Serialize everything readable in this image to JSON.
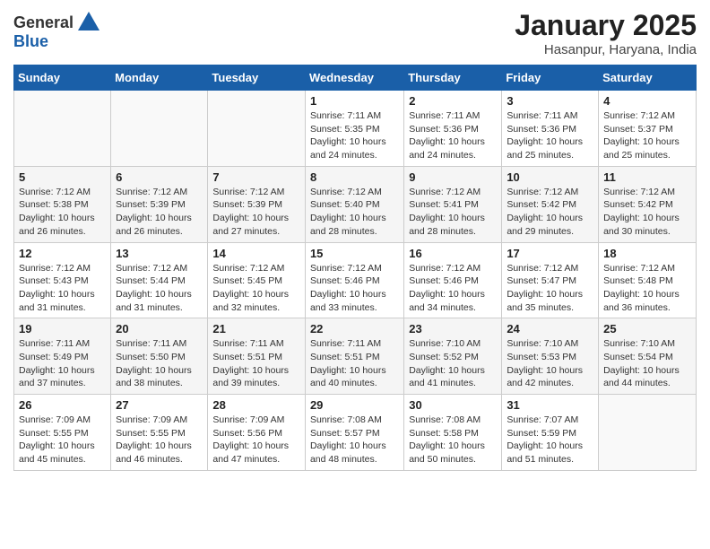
{
  "header": {
    "logo_line1": "General",
    "logo_line2": "Blue",
    "month_title": "January 2025",
    "location": "Hasanpur, Haryana, India"
  },
  "weekdays": [
    "Sunday",
    "Monday",
    "Tuesday",
    "Wednesday",
    "Thursday",
    "Friday",
    "Saturday"
  ],
  "weeks": [
    [
      {
        "day": "",
        "info": ""
      },
      {
        "day": "",
        "info": ""
      },
      {
        "day": "",
        "info": ""
      },
      {
        "day": "1",
        "info": "Sunrise: 7:11 AM\nSunset: 5:35 PM\nDaylight: 10 hours\nand 24 minutes."
      },
      {
        "day": "2",
        "info": "Sunrise: 7:11 AM\nSunset: 5:36 PM\nDaylight: 10 hours\nand 24 minutes."
      },
      {
        "day": "3",
        "info": "Sunrise: 7:11 AM\nSunset: 5:36 PM\nDaylight: 10 hours\nand 25 minutes."
      },
      {
        "day": "4",
        "info": "Sunrise: 7:12 AM\nSunset: 5:37 PM\nDaylight: 10 hours\nand 25 minutes."
      }
    ],
    [
      {
        "day": "5",
        "info": "Sunrise: 7:12 AM\nSunset: 5:38 PM\nDaylight: 10 hours\nand 26 minutes."
      },
      {
        "day": "6",
        "info": "Sunrise: 7:12 AM\nSunset: 5:39 PM\nDaylight: 10 hours\nand 26 minutes."
      },
      {
        "day": "7",
        "info": "Sunrise: 7:12 AM\nSunset: 5:39 PM\nDaylight: 10 hours\nand 27 minutes."
      },
      {
        "day": "8",
        "info": "Sunrise: 7:12 AM\nSunset: 5:40 PM\nDaylight: 10 hours\nand 28 minutes."
      },
      {
        "day": "9",
        "info": "Sunrise: 7:12 AM\nSunset: 5:41 PM\nDaylight: 10 hours\nand 28 minutes."
      },
      {
        "day": "10",
        "info": "Sunrise: 7:12 AM\nSunset: 5:42 PM\nDaylight: 10 hours\nand 29 minutes."
      },
      {
        "day": "11",
        "info": "Sunrise: 7:12 AM\nSunset: 5:42 PM\nDaylight: 10 hours\nand 30 minutes."
      }
    ],
    [
      {
        "day": "12",
        "info": "Sunrise: 7:12 AM\nSunset: 5:43 PM\nDaylight: 10 hours\nand 31 minutes."
      },
      {
        "day": "13",
        "info": "Sunrise: 7:12 AM\nSunset: 5:44 PM\nDaylight: 10 hours\nand 31 minutes."
      },
      {
        "day": "14",
        "info": "Sunrise: 7:12 AM\nSunset: 5:45 PM\nDaylight: 10 hours\nand 32 minutes."
      },
      {
        "day": "15",
        "info": "Sunrise: 7:12 AM\nSunset: 5:46 PM\nDaylight: 10 hours\nand 33 minutes."
      },
      {
        "day": "16",
        "info": "Sunrise: 7:12 AM\nSunset: 5:46 PM\nDaylight: 10 hours\nand 34 minutes."
      },
      {
        "day": "17",
        "info": "Sunrise: 7:12 AM\nSunset: 5:47 PM\nDaylight: 10 hours\nand 35 minutes."
      },
      {
        "day": "18",
        "info": "Sunrise: 7:12 AM\nSunset: 5:48 PM\nDaylight: 10 hours\nand 36 minutes."
      }
    ],
    [
      {
        "day": "19",
        "info": "Sunrise: 7:11 AM\nSunset: 5:49 PM\nDaylight: 10 hours\nand 37 minutes."
      },
      {
        "day": "20",
        "info": "Sunrise: 7:11 AM\nSunset: 5:50 PM\nDaylight: 10 hours\nand 38 minutes."
      },
      {
        "day": "21",
        "info": "Sunrise: 7:11 AM\nSunset: 5:51 PM\nDaylight: 10 hours\nand 39 minutes."
      },
      {
        "day": "22",
        "info": "Sunrise: 7:11 AM\nSunset: 5:51 PM\nDaylight: 10 hours\nand 40 minutes."
      },
      {
        "day": "23",
        "info": "Sunrise: 7:10 AM\nSunset: 5:52 PM\nDaylight: 10 hours\nand 41 minutes."
      },
      {
        "day": "24",
        "info": "Sunrise: 7:10 AM\nSunset: 5:53 PM\nDaylight: 10 hours\nand 42 minutes."
      },
      {
        "day": "25",
        "info": "Sunrise: 7:10 AM\nSunset: 5:54 PM\nDaylight: 10 hours\nand 44 minutes."
      }
    ],
    [
      {
        "day": "26",
        "info": "Sunrise: 7:09 AM\nSunset: 5:55 PM\nDaylight: 10 hours\nand 45 minutes."
      },
      {
        "day": "27",
        "info": "Sunrise: 7:09 AM\nSunset: 5:55 PM\nDaylight: 10 hours\nand 46 minutes."
      },
      {
        "day": "28",
        "info": "Sunrise: 7:09 AM\nSunset: 5:56 PM\nDaylight: 10 hours\nand 47 minutes."
      },
      {
        "day": "29",
        "info": "Sunrise: 7:08 AM\nSunset: 5:57 PM\nDaylight: 10 hours\nand 48 minutes."
      },
      {
        "day": "30",
        "info": "Sunrise: 7:08 AM\nSunset: 5:58 PM\nDaylight: 10 hours\nand 50 minutes."
      },
      {
        "day": "31",
        "info": "Sunrise: 7:07 AM\nSunset: 5:59 PM\nDaylight: 10 hours\nand 51 minutes."
      },
      {
        "day": "",
        "info": ""
      }
    ]
  ]
}
